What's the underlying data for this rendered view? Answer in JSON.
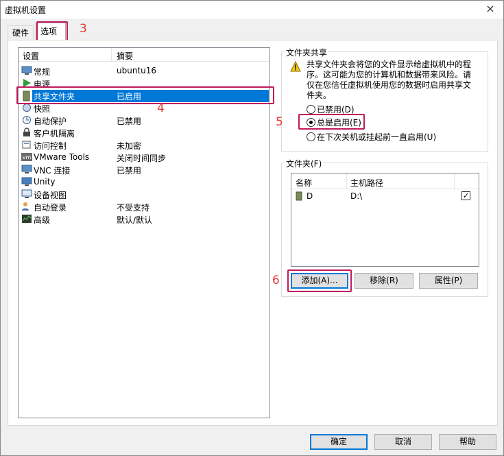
{
  "window": {
    "title": "虚拟机设置",
    "close_icon": "×"
  },
  "tabs": [
    {
      "label": "硬件"
    },
    {
      "label": "选项"
    }
  ],
  "markers": {
    "m3": "3",
    "m4": "4",
    "m5": "5",
    "m6": "6"
  },
  "settings_list": {
    "headers": {
      "setting": "设置",
      "summary": "摘要"
    },
    "items": [
      {
        "name": "常规",
        "summary": "ubuntu16",
        "icon": "monitor-icon"
      },
      {
        "name": "电源",
        "summary": "",
        "icon": "play-icon"
      },
      {
        "name": "共享文件夹",
        "summary": "已启用",
        "icon": "folder-icon",
        "selected": true
      },
      {
        "name": "快照",
        "summary": "",
        "icon": "snapshot-icon"
      },
      {
        "name": "自动保护",
        "summary": "已禁用",
        "icon": "clock-icon"
      },
      {
        "name": "客户机隔离",
        "summary": "",
        "icon": "lock-icon"
      },
      {
        "name": "访问控制",
        "summary": "未加密",
        "icon": "access-icon"
      },
      {
        "name": "VMware Tools",
        "summary": "关闭时间同步",
        "icon": "vmware-icon"
      },
      {
        "name": "VNC 连接",
        "summary": "已禁用",
        "icon": "vnc-icon"
      },
      {
        "name": "Unity",
        "summary": "",
        "icon": "unity-icon"
      },
      {
        "name": "设备视图",
        "summary": "",
        "icon": "device-icon"
      },
      {
        "name": "自动登录",
        "summary": "不受支持",
        "icon": "user-icon"
      },
      {
        "name": "高级",
        "summary": "默认/默认",
        "icon": "chart-icon"
      }
    ]
  },
  "sharing": {
    "group_label": "文件夹共享",
    "warning": "共享文件夹会将您的文件显示给虚拟机中的程序。这可能为您的计算机和数据带来风险。请仅在您信任虚拟机使用您的数据时启用共享文件夹。",
    "options": [
      {
        "label": "已禁用(D)",
        "checked": false
      },
      {
        "label": "总是启用(E)",
        "checked": true
      },
      {
        "label": "在下次关机或挂起前一直启用(U)",
        "checked": false
      }
    ]
  },
  "folders": {
    "group_label": "文件夹(F)",
    "headers": {
      "name": "名称",
      "path": "主机路径"
    },
    "rows": [
      {
        "name": "D",
        "path": "D:\\",
        "enabled": true,
        "check": "✓"
      }
    ],
    "buttons": {
      "add": "添加(A)...",
      "remove": "移除(R)",
      "properties": "属性(P)"
    }
  },
  "footer": {
    "ok": "确定",
    "cancel": "取消",
    "help": "帮助"
  }
}
